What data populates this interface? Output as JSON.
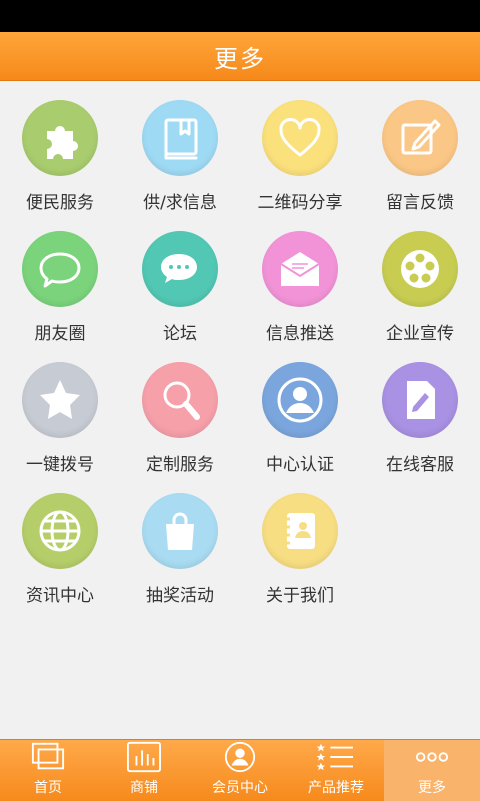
{
  "header": {
    "title": "更多"
  },
  "grid": [
    {
      "label": "便民服务",
      "icon": "puzzle-icon",
      "color": "#a9cd6e"
    },
    {
      "label": "供/求信息",
      "icon": "book-icon",
      "color": "#9fdaf5"
    },
    {
      "label": "二维码分享",
      "icon": "heart-icon",
      "color": "#fbe17c"
    },
    {
      "label": "留言反馈",
      "icon": "edit-note-icon",
      "color": "#fbc786"
    },
    {
      "label": "朋友圈",
      "icon": "chat-bubble-icon",
      "color": "#7bd47c"
    },
    {
      "label": "论坛",
      "icon": "forum-bubbles-icon",
      "color": "#52c8b4"
    },
    {
      "label": "信息推送",
      "icon": "mail-icon",
      "color": "#f293d8"
    },
    {
      "label": "企业宣传",
      "icon": "film-reel-icon",
      "color": "#c8cd52"
    },
    {
      "label": "一键拨号",
      "icon": "star-icon",
      "color": "#c7cbd3"
    },
    {
      "label": "定制服务",
      "icon": "magnifier-icon",
      "color": "#f6a0aa"
    },
    {
      "label": "中心认证",
      "icon": "user-icon",
      "color": "#7ba6dd"
    },
    {
      "label": "在线客服",
      "icon": "document-edit-icon",
      "color": "#a991e3"
    },
    {
      "label": "资讯中心",
      "icon": "globe-icon",
      "color": "#b6ce6a"
    },
    {
      "label": "抽奖活动",
      "icon": "shopping-bag-icon",
      "color": "#a9dcf2"
    },
    {
      "label": "关于我们",
      "icon": "contact-book-icon",
      "color": "#f8de82"
    }
  ],
  "tabs": [
    {
      "label": "首页",
      "icon": "home-screens-icon",
      "active": false
    },
    {
      "label": "商铺",
      "icon": "bar-chart-icon",
      "active": false
    },
    {
      "label": "会员中心",
      "icon": "member-icon",
      "active": false
    },
    {
      "label": "产品推荐",
      "icon": "star-list-icon",
      "active": false
    },
    {
      "label": "更多",
      "icon": "more-dots-icon",
      "active": true
    }
  ]
}
